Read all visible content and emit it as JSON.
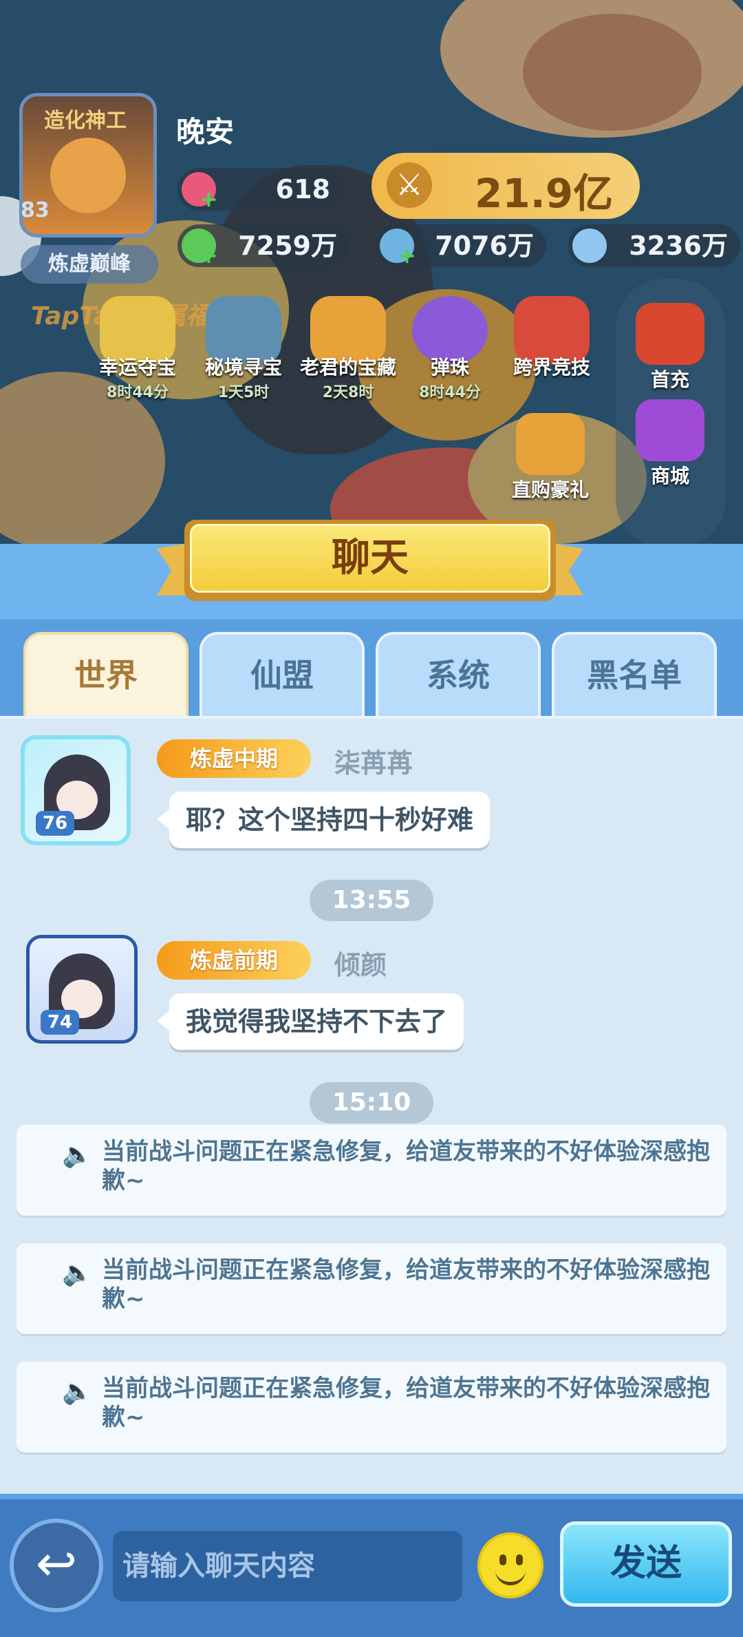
{
  "hud": {
    "avatar_title": "造化神工",
    "level": "83",
    "realm": "炼虚巅峰",
    "player_name": "晚安",
    "resources": [
      {
        "icon": "peach-icon",
        "value": "618",
        "color": "#e95a7a"
      },
      {
        "icon": "green-jade-icon",
        "value": "7259万",
        "color": "#5cc95a"
      },
      {
        "icon": "blue-crystal-icon",
        "value": "7076万",
        "color": "#6fb4e0"
      },
      {
        "icon": "rainbow-crystal-icon",
        "value": "3236万",
        "color": "#8fc7f0"
      }
    ],
    "combat_power": "21.9亿",
    "taptap_label": "TapTap 专属福利"
  },
  "features": [
    {
      "label": "幸运夺宝",
      "time": "8时44分"
    },
    {
      "label": "秘境寻宝",
      "time": "1天5时"
    },
    {
      "label": "老君的宝藏",
      "time": "2天8时"
    },
    {
      "label": "弹珠",
      "time": "8时44分"
    },
    {
      "label": "跨界竞技",
      "time": ""
    }
  ],
  "side_icons": [
    {
      "label": "首充"
    },
    {
      "label": "商城"
    },
    {
      "label": "直购豪礼"
    }
  ],
  "chat": {
    "title": "聊天",
    "tabs": [
      "世界",
      "仙盟",
      "系统",
      "黑名单"
    ],
    "messages": [
      {
        "rank": "炼虚中期",
        "user": "柒苒苒",
        "level": "76",
        "text": "耶？这个坚持四十秒好难"
      },
      {
        "time": "13:55"
      },
      {
        "rank": "炼虚前期",
        "user": "倾颜",
        "level": "74",
        "text": "我觉得我坚持不下去了"
      },
      {
        "time": "15:10"
      }
    ],
    "system_notices": [
      "当前战斗问题正在紧急修复，给道友带来的不好体验深感抱歉~",
      "当前战斗问题正在紧急修复，给道友带来的不好体验深感抱歉~",
      "当前战斗问题正在紧急修复，给道友带来的不好体验深感抱歉~"
    ],
    "input_placeholder": "请输入聊天内容",
    "send_label": "发送",
    "back_glyph": "↩"
  }
}
